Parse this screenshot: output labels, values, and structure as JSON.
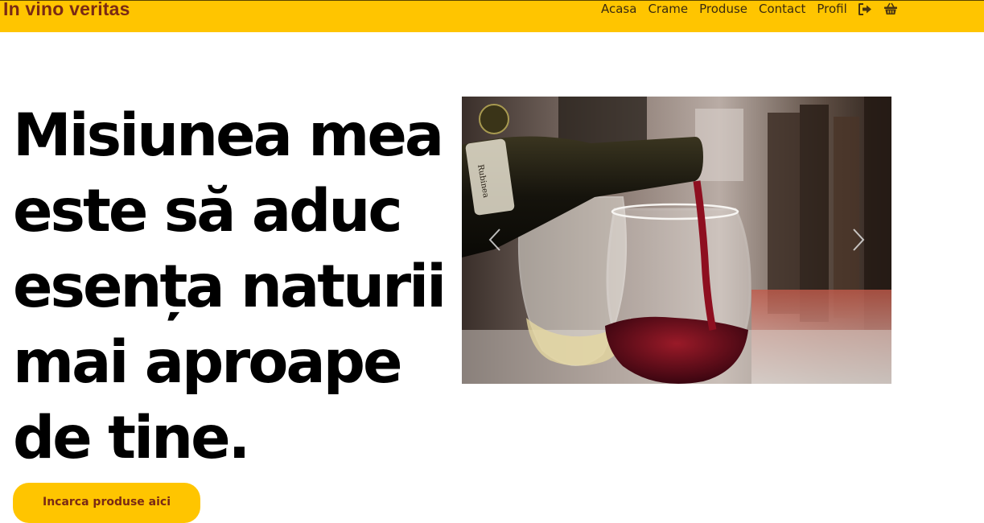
{
  "header": {
    "brand": "In vino veritas",
    "nav": [
      {
        "label": "Acasa"
      },
      {
        "label": "Crame"
      },
      {
        "label": "Produse"
      },
      {
        "label": "Contact"
      },
      {
        "label": "Profil"
      }
    ],
    "icons": [
      "sign-out-icon",
      "shopping-basket-icon"
    ]
  },
  "hero": {
    "title": "Misiunea mea este să aduc esența naturii mai aproape de tine.",
    "upload_button": "Incarca produse aici"
  },
  "carousel": {
    "controls": [
      "previous-icon",
      "next-icon"
    ]
  },
  "colors": {
    "accent": "#ffc500",
    "brand_text": "#7a2a14"
  }
}
